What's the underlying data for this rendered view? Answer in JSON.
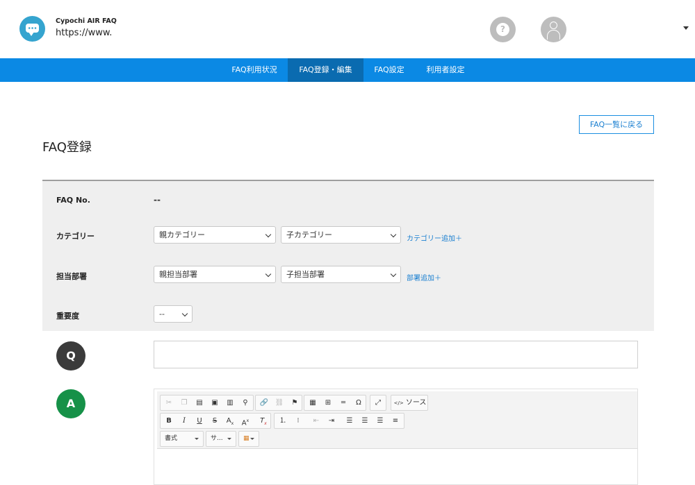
{
  "header": {
    "app_name": "Cypochi AIR FAQ",
    "url": "https://www."
  },
  "nav": {
    "items": [
      {
        "label": "FAQ利用状況",
        "active": false
      },
      {
        "label": "FAQ登録・編集",
        "active": true
      },
      {
        "label": "FAQ設定",
        "active": false
      },
      {
        "label": "利用者設定",
        "active": false
      }
    ]
  },
  "page": {
    "title": "FAQ登録",
    "back_button": "FAQ一覧に戻る"
  },
  "form": {
    "faq_no_label": "FAQ No.",
    "faq_no_value": "--",
    "category_label": "カテゴリー",
    "parent_category": "親カテゴリー",
    "child_category": "子カテゴリー",
    "add_category": "カテゴリー追加＋",
    "department_label": "担当部署",
    "parent_department": "親担当部署",
    "child_department": "子担当部署",
    "add_department": "部署追加＋",
    "importance_label": "重要度",
    "importance_value": "--"
  },
  "qa": {
    "q_badge": "Q",
    "a_badge": "A"
  },
  "editor": {
    "source_label": "ソース",
    "format_combo": "書式",
    "size_combo": "サ..."
  },
  "colors": {
    "nav_bg": "#0b89e4",
    "nav_active": "#0a6bb0",
    "logo": "#35a4cf",
    "q_badge": "#3b3b3b",
    "a_badge": "#169148",
    "link": "#1a7fd0"
  }
}
